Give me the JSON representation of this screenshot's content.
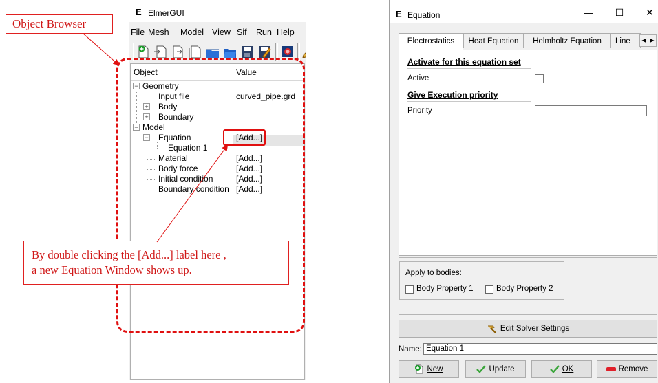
{
  "annotations": {
    "object_browser_label": "Object Browser",
    "callout_line1": "By double clicking the [Add...] label here ,",
    "callout_line2": "a new Equation Window shows up."
  },
  "main_window": {
    "title": "ElmerGUI",
    "logo": "E",
    "menu": [
      "File",
      "Mesh",
      "Model",
      "View",
      "Sif",
      "Run",
      "Help"
    ],
    "tree_header": {
      "object": "Object",
      "value": "Value"
    },
    "tree": {
      "geometry": "Geometry",
      "input_file": "Input file",
      "input_file_value": "curved_pipe.grd",
      "body": "Body",
      "boundary": "Boundary",
      "model": "Model",
      "equation": "Equation",
      "equation_value": "[Add...]",
      "equation_1": "Equation 1",
      "material": "Material",
      "material_value": "[Add...]",
      "body_force": "Body force",
      "body_force_value": "[Add...]",
      "initial_condition": "Initial condition",
      "initial_condition_value": "[Add...]",
      "boundary_condition": "Boundary condition",
      "boundary_condition_value": "[Add...]"
    }
  },
  "equation_window": {
    "title": "Equation",
    "logo": "E",
    "minimize": "—",
    "maximize": "☐",
    "close": "✕",
    "tabs": [
      "Electrostatics",
      "Heat Equation",
      "Helmholtz Equation",
      "Line"
    ],
    "section_activate": "Activate for this equation set",
    "active_label": "Active",
    "section_priority": "Give Execution priority",
    "priority_label": "Priority",
    "apply_to_bodies": "Apply to bodies:",
    "body_property_1": "Body Property 1",
    "body_property_2": "Body Property 2",
    "edit_solver_settings": "Edit Solver Settings",
    "name_label": "Name:",
    "name_value": "Equation 1",
    "btn_new": "New",
    "btn_update": "Update",
    "btn_ok": "OK",
    "btn_remove": "Remove"
  }
}
